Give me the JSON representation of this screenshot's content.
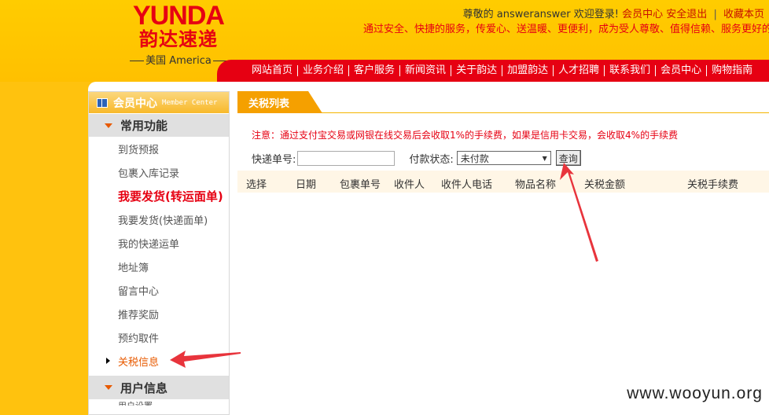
{
  "logo": {
    "en": "YUNDA",
    "cn": "韵达速递",
    "sub": "美国 America"
  },
  "top_links": {
    "greeting": "尊敬的 answeranswer 欢迎登录!",
    "member_center": "会员中心",
    "logout": "安全退出",
    "separator": "|",
    "bookmark": "收藏本页"
  },
  "slogan": "通过安全、快捷的服务，传爱心、送温暖、更便利，成为受人尊敬、值得信赖、服务更好的",
  "nav": [
    "网站首页",
    "业务介绍",
    "客户服务",
    "新闻资讯",
    "关于韵达",
    "加盟韵达",
    "人才招聘",
    "联系我们",
    "会员中心",
    "购物指南"
  ],
  "sidebar": {
    "title": "会员中心",
    "title_en": "Member Center",
    "group1": "常用功能",
    "items": [
      {
        "label": "到货预报"
      },
      {
        "label": "包裹入库记录"
      },
      {
        "label": "我要发货(转运面单)"
      },
      {
        "label": "我要发货(快递面单)"
      },
      {
        "label": "我的快递运单"
      },
      {
        "label": "地址簿"
      },
      {
        "label": "留言中心"
      },
      {
        "label": "推荐奖励"
      },
      {
        "label": "预约取件"
      },
      {
        "label": "关税信息"
      }
    ],
    "group2": "用户信息",
    "group2_first": "用户设置"
  },
  "content": {
    "tab": "关税列表",
    "notice": "注意：通过支付宝交易或网银在线交易后会收取1%的手续费，如果是信用卡交易，会收取4%的手续费",
    "search": {
      "tracking_label": "快递单号:",
      "tracking_value": "",
      "status_label": "付款状态:",
      "status_selected": "未付款",
      "query_button": "查询"
    },
    "table_headers": [
      "选择",
      "日期",
      "包裹单号",
      "收件人",
      "收件人电话",
      "物品名称",
      "关税金额",
      "关税手续费"
    ]
  },
  "watermark": "www.wooyun.org",
  "colors": {
    "brand_red": "#e60012",
    "brand_yellow": "#ffc20e",
    "tab_orange": "#f5a000"
  }
}
